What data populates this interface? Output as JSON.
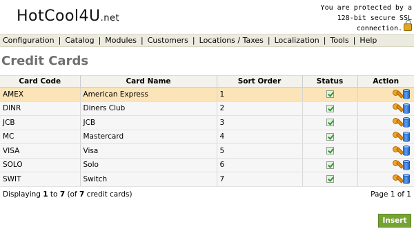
{
  "header": {
    "logo_main": "HotCool4U",
    "logo_suffix": ".net",
    "ssl_line1": "You are protected by a",
    "ssl_line2": "128-bit secure SSL",
    "ssl_line3": "connection."
  },
  "menu": [
    "Configuration",
    "Catalog",
    "Modules",
    "Customers",
    "Locations / Taxes",
    "Localization",
    "Tools",
    "Help"
  ],
  "page_title": "Credit Cards",
  "table": {
    "headers": [
      "Card Code",
      "Card Name",
      "Sort Order",
      "Status",
      "Action"
    ],
    "rows": [
      {
        "code": "AMEX",
        "name": "American Express",
        "sort": "1",
        "status": "active",
        "selected": true
      },
      {
        "code": "DINR",
        "name": "Diners Club",
        "sort": "2",
        "status": "active",
        "selected": false
      },
      {
        "code": "JCB",
        "name": "JCB",
        "sort": "3",
        "status": "active",
        "selected": false
      },
      {
        "code": "MC",
        "name": "Mastercard",
        "sort": "4",
        "status": "active",
        "selected": false
      },
      {
        "code": "VISA",
        "name": "Visa",
        "sort": "5",
        "status": "active",
        "selected": false
      },
      {
        "code": "SOLO",
        "name": "Solo",
        "sort": "6",
        "status": "active",
        "selected": false
      },
      {
        "code": "SWIT",
        "name": "Switch",
        "sort": "7",
        "status": "active",
        "selected": false
      }
    ]
  },
  "footer": {
    "displaying_prefix": "Displaying ",
    "range_start": "1",
    "to": " to ",
    "range_end": "7",
    "of_prefix": " (of ",
    "total": "7",
    "suffix": " credit cards)",
    "page_info": "Page 1 of 1"
  },
  "insert_label": "Insert",
  "colors": {
    "selected_row": "#fbe4b8",
    "menu_bg": "#ecebe0",
    "insert_button": "#76a434",
    "title": "#6f6f6f"
  },
  "icons": {
    "status": "check-icon",
    "edit": "wrench-icon",
    "delete": "database-icon",
    "ssl": "lock-icon"
  }
}
